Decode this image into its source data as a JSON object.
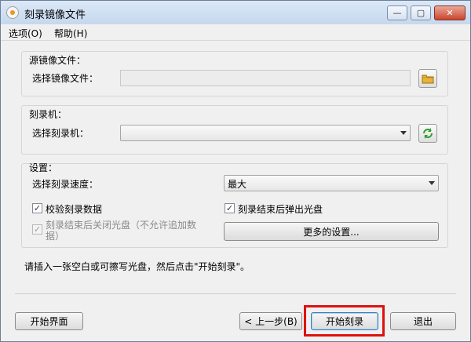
{
  "window": {
    "title": "刻录镜像文件"
  },
  "titlebar_buttons": {
    "minimize": "—",
    "restore": "▢",
    "close": "✕"
  },
  "menu": {
    "options": "选项(O)",
    "help": "帮助(H)"
  },
  "source": {
    "group_label": "源镜像文件：",
    "field_label": "选择镜像文件：",
    "path_value": ""
  },
  "burner": {
    "group_label": "刻录机：",
    "field_label": "选择刻录机：",
    "selected": ""
  },
  "settings": {
    "group_label": "设置：",
    "speed_label": "选择刻录速度：",
    "speed_value": "最大",
    "verify_label": "校验刻录数据",
    "verify_checked": true,
    "eject_label": "刻录结束后弹出光盘",
    "eject_checked": true,
    "close_disc_label_line1": "刻录结束后关闭光盘（不允许追加数",
    "close_disc_label_line2": "据）",
    "close_disc_checked": true,
    "close_disc_enabled": false,
    "more_settings_label": "更多的设置..."
  },
  "instruction": "请插入一张空白或可擦写光盘，然后点击\"开始刻录\"。",
  "footer": {
    "home_label": "开始界面",
    "back_label": "< 上一步(B)",
    "start_label": "开始刻录",
    "exit_label": "退出"
  },
  "colors": {
    "highlight_box": "#e01010",
    "icon_refresh": "#2e9d32",
    "icon_folder": "#e8b33a"
  }
}
